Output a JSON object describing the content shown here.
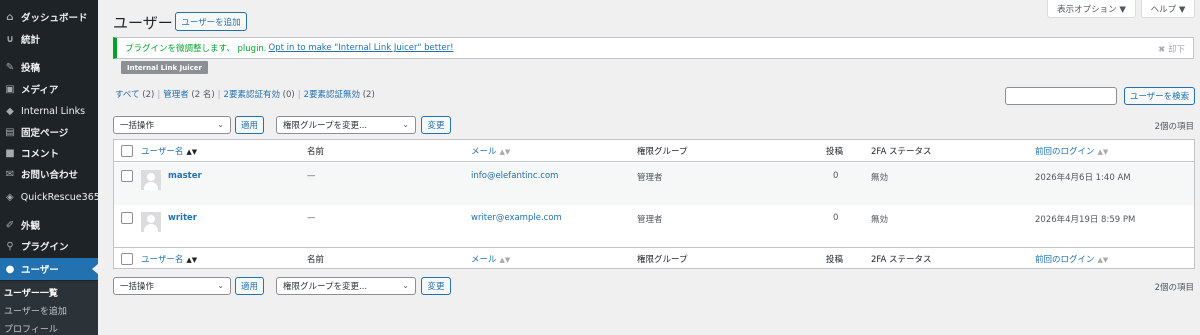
{
  "sidebar": {
    "items": [
      {
        "label": "ダッシュボード",
        "icon": "dashboard-icon",
        "glyph": "⌂"
      },
      {
        "label": "統計",
        "icon": "stats-icon",
        "glyph": "∪"
      },
      {
        "label": "投稿",
        "icon": "pin-icon",
        "glyph": "✎"
      },
      {
        "label": "メディア",
        "icon": "media-icon",
        "glyph": "▣"
      },
      {
        "label": "Internal Links",
        "icon": "link-juicer-icon",
        "glyph": "◆"
      },
      {
        "label": "固定ページ",
        "icon": "page-icon",
        "glyph": "▤"
      },
      {
        "label": "コメント",
        "icon": "comment-icon",
        "glyph": "■"
      },
      {
        "label": "お問い合わせ",
        "icon": "mail-icon",
        "glyph": "✉"
      },
      {
        "label": "QuickRescue365",
        "icon": "shield-icon",
        "glyph": "◈"
      },
      {
        "label": "外観",
        "icon": "brush-icon",
        "glyph": "✐"
      },
      {
        "label": "プラグイン",
        "icon": "plugin-icon",
        "glyph": "⚲"
      },
      {
        "label": "ユーザー",
        "icon": "user-icon",
        "glyph": "●"
      }
    ],
    "submenu": [
      "ユーザー一覧",
      "ユーザーを追加",
      "プロフィール"
    ]
  },
  "top_tabs": {
    "screen_options": "表示オプション ▼",
    "help": "ヘルプ ▼"
  },
  "header": {
    "title": "ユーザー",
    "add_button": "ユーザーを追加"
  },
  "notice": {
    "text": "プラグインを微調整します、 plugin.",
    "link": "Opt in to make \"Internal Link Juicer\" better!",
    "dismiss": "✖ 却下",
    "badge": "Internal Link Juicer"
  },
  "filters": [
    {
      "label": "すべて",
      "count": "(2)"
    },
    {
      "label": "管理者",
      "count": "(2 名)"
    },
    {
      "label": "2要素認証有効",
      "count": "(0)"
    },
    {
      "label": "2要素認証無効",
      "count": "(2)"
    }
  ],
  "search": {
    "value": "",
    "button": "ユーザーを検索"
  },
  "bulk": {
    "action_select": "一括操作",
    "apply": "適用",
    "role_select": "権限グループを変更...",
    "change": "変更",
    "items_count": "2個の項目"
  },
  "table": {
    "columns": [
      "ユーザー名",
      "名前",
      "メール",
      "権限グループ",
      "投稿",
      "2FA ステータス",
      "前回のログイン"
    ],
    "sort_indicators": {
      "username": "▲▼",
      "email": "▲▼",
      "last_login": "▲▼"
    },
    "rows": [
      {
        "username": "master",
        "name": "—",
        "email": "info@elefantinc.com",
        "role": "管理者",
        "posts": "0",
        "twofa": "無効",
        "last_login": "2026年4月6日 1:40 AM"
      },
      {
        "username": "writer",
        "name": "—",
        "email": "writer@example.com",
        "role": "管理者",
        "posts": "0",
        "twofa": "無効",
        "last_login": "2026年4月19日 8:59 PM"
      }
    ]
  }
}
